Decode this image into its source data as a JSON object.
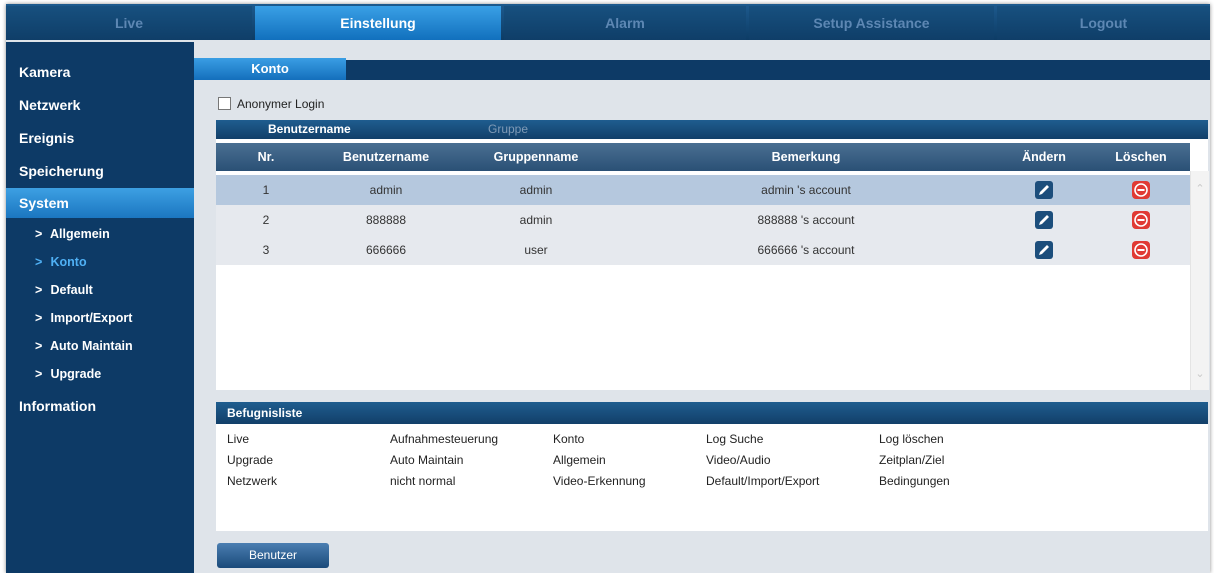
{
  "topnav": {
    "tabs": [
      {
        "label": "Live"
      },
      {
        "label": "Einstellung",
        "active": true
      },
      {
        "label": "Alarm"
      },
      {
        "label": "Setup Assistance"
      },
      {
        "label": "Logout"
      }
    ]
  },
  "sidebar": {
    "items": [
      {
        "label": "Kamera"
      },
      {
        "label": "Netzwerk"
      },
      {
        "label": "Ereignis"
      },
      {
        "label": "Speicherung"
      },
      {
        "label": "System",
        "active": true
      },
      {
        "label": "Information"
      }
    ],
    "sub_items": [
      {
        "label": "Allgemein"
      },
      {
        "label": "Konto",
        "active": true
      },
      {
        "label": "Default"
      },
      {
        "label": "Import/Export"
      },
      {
        "label": "Auto Maintain"
      },
      {
        "label": "Upgrade"
      }
    ],
    "chevron": ">"
  },
  "page": {
    "tab_title": "Konto",
    "anonymous_login": {
      "label": "Anonymer Login",
      "checked": false
    }
  },
  "account_table": {
    "subtabs": [
      {
        "label": "Benutzername",
        "active": true
      },
      {
        "label": "Gruppe",
        "active": false
      }
    ],
    "columns": [
      "Nr.",
      "Benutzername",
      "Gruppenname",
      "Bemerkung",
      "Ändern",
      "Löschen"
    ],
    "rows": [
      {
        "nr": "1",
        "user": "admin",
        "group": "admin",
        "remark": "admin 's account",
        "selected": true
      },
      {
        "nr": "2",
        "user": "888888",
        "group": "admin",
        "remark": "888888 's account",
        "selected": false
      },
      {
        "nr": "3",
        "user": "666666",
        "group": "user",
        "remark": "666666 's account",
        "selected": false
      }
    ],
    "edit_icon": "edit-pencil-icon",
    "delete_icon": "delete-minus-icon"
  },
  "permissions": {
    "title": "Befugnisliste",
    "columns": [
      [
        "Live",
        "Upgrade",
        "Netzwerk"
      ],
      [
        "Aufnahmesteuerung",
        "Auto Maintain",
        "nicht normal"
      ],
      [
        "Konto",
        "Allgemein",
        "Video-Erkennung"
      ],
      [
        "Log Suche",
        "Video/Audio",
        "Default/Import/Export"
      ],
      [
        "Log löschen",
        "Zeitplan/Ziel",
        "Bedingungen"
      ]
    ]
  },
  "footer": {
    "user_button": "Benutzer"
  },
  "colors": {
    "nav_dark": "#0d3a66",
    "accent_blue": "#1b76c0",
    "active_sub": "#4fb0f4",
    "row_selected": "#b5c8de",
    "row_alt": "#e6e9ee",
    "delete_red": "#e03a34"
  }
}
